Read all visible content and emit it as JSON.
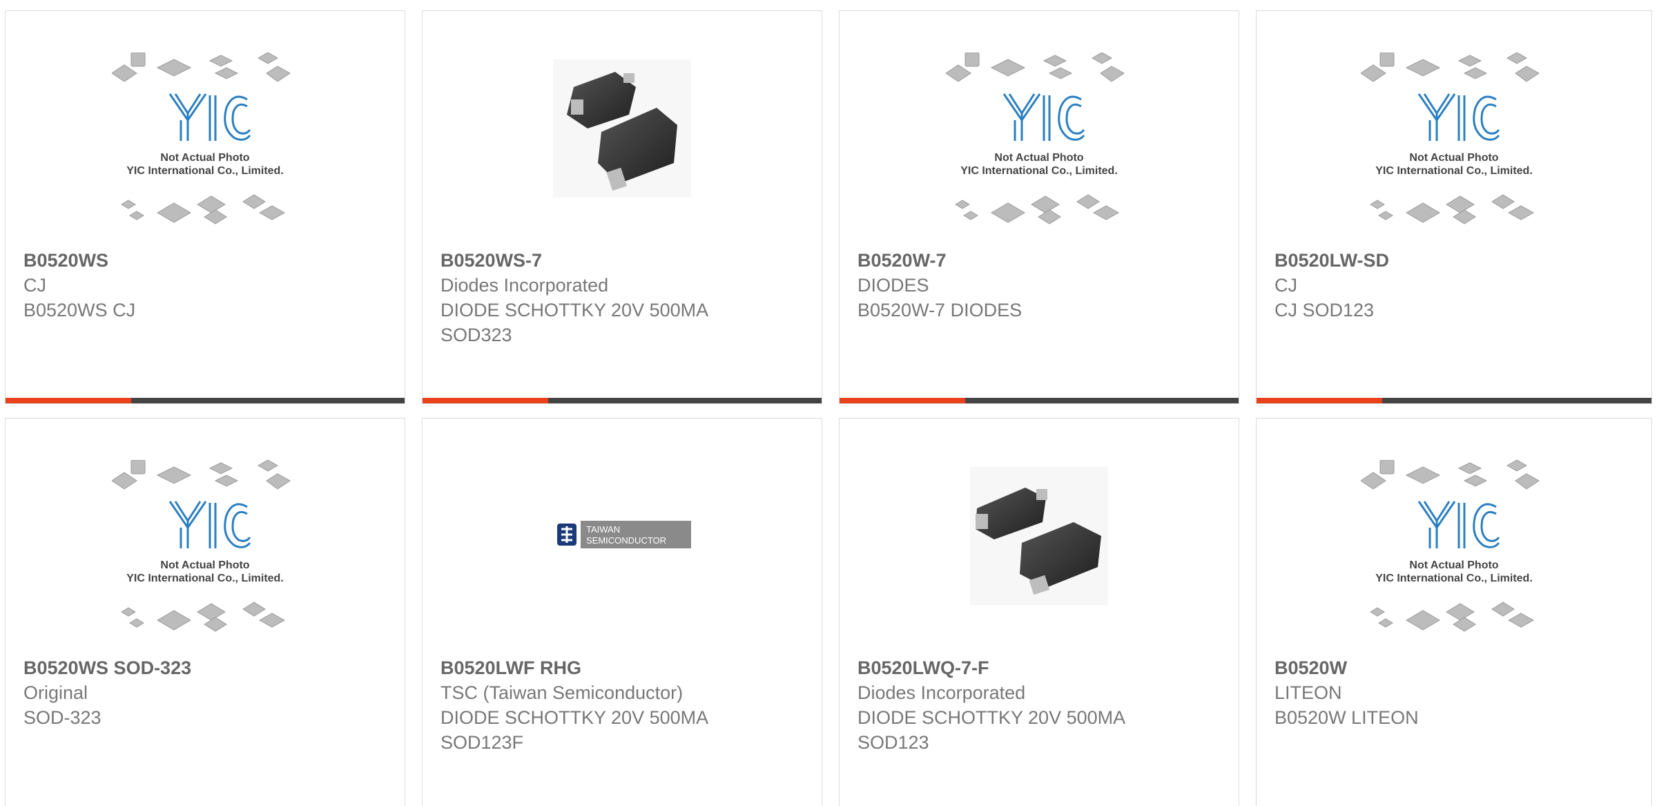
{
  "placeholder": {
    "logo": "YIC",
    "caption1": "Not Actual Photo",
    "caption2": "YIC International Co., Limited."
  },
  "tsc_logo": {
    "line1": "TAIWAN",
    "line2": "SEMICONDUCTOR"
  },
  "colors": {
    "accent": "#e8411b",
    "bar": "#444444",
    "yic_blue": "#2a7fc1"
  },
  "products": [
    {
      "part": "B0520WS",
      "line1": "CJ",
      "line2": "B0520WS CJ",
      "line3": "",
      "image": "yic-placeholder"
    },
    {
      "part": "B0520WS-7",
      "line1": "Diodes Incorporated",
      "line2": "DIODE SCHOTTKY 20V 500MA",
      "line3": "SOD323",
      "image": "diode-sod323-photo"
    },
    {
      "part": "B0520W-7",
      "line1": "DIODES",
      "line2": "B0520W-7 DIODES",
      "line3": "",
      "image": "yic-placeholder"
    },
    {
      "part": "B0520LW-SD",
      "line1": "CJ",
      "line2": "CJ SOD123",
      "line3": "",
      "image": "yic-placeholder"
    },
    {
      "part": "B0520WS SOD-323",
      "line1": "Original",
      "line2": "SOD-323",
      "line3": "",
      "image": "yic-placeholder"
    },
    {
      "part": "B0520LWF RHG",
      "line1": "TSC (Taiwan Semiconductor)",
      "line2": "DIODE SCHOTTKY 20V 500MA",
      "line3": "SOD123F",
      "image": "tsc-logo"
    },
    {
      "part": "B0520LWQ-7-F",
      "line1": "Diodes Incorporated",
      "line2": "DIODE SCHOTTKY 20V 500MA",
      "line3": "SOD123",
      "image": "diode-sod123-photo"
    },
    {
      "part": "B0520W",
      "line1": "LITEON",
      "line2": "B0520W LITEON",
      "line3": "",
      "image": "yic-placeholder"
    }
  ]
}
